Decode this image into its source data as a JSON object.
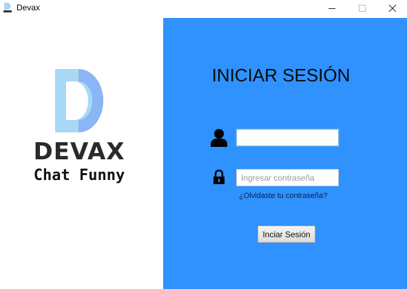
{
  "window": {
    "title": "Devax",
    "icon": "devax-app-icon",
    "controls": [
      "minimize-icon",
      "maximize-icon",
      "close-icon"
    ]
  },
  "branding": {
    "name": "DEVAX",
    "tagline": "Chat Funny",
    "logo": "letter-d-logo",
    "colors": {
      "logo_light": "#a8d8f4",
      "logo_dark": "#8ab6f5"
    }
  },
  "login": {
    "title": "INICIAR SESIÓN",
    "username": {
      "value": "",
      "placeholder": "",
      "icon": "user-icon"
    },
    "password": {
      "value": "",
      "placeholder": "Ingresar contraseña",
      "icon": "lock-icon"
    },
    "forgot_password": "¿Olvidaste tu contraseña?",
    "submit_label": "Inciar Sesión",
    "panel_color": "#2f92ff"
  }
}
